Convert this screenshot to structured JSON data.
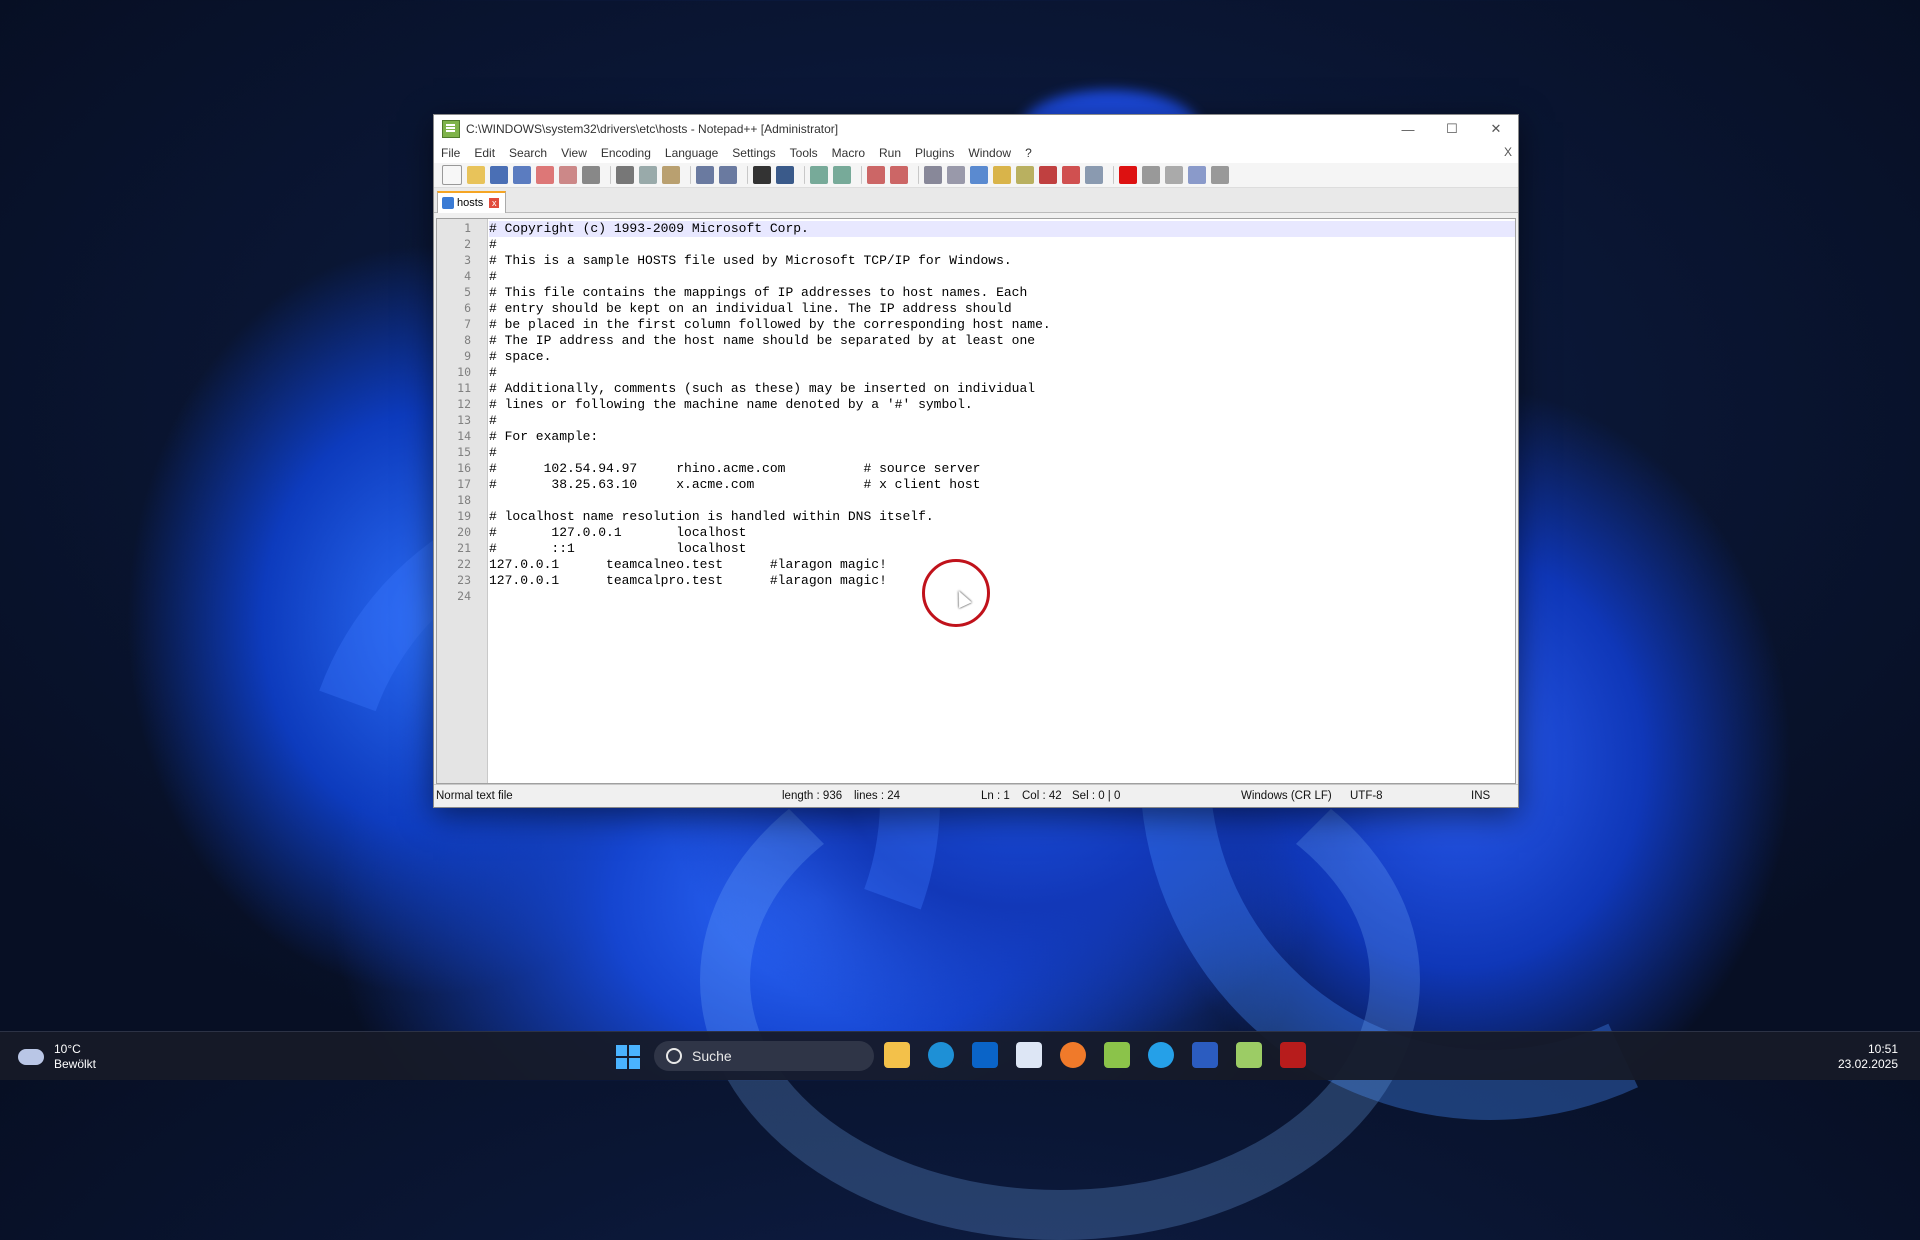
{
  "window": {
    "title": "C:\\WINDOWS\\system32\\drivers\\etc\\hosts - Notepad++ [Administrator]",
    "controls": [
      "—",
      "☐",
      "✕"
    ]
  },
  "menu": {
    "items": [
      "File",
      "Edit",
      "Search",
      "View",
      "Encoding",
      "Language",
      "Settings",
      "Tools",
      "Macro",
      "Run",
      "Plugins",
      "Window",
      "?"
    ],
    "close_label": "X"
  },
  "tab": {
    "label": "hosts"
  },
  "editor": {
    "lines": [
      "# Copyright (c) 1993-2009 Microsoft Corp.",
      "#",
      "# This is a sample HOSTS file used by Microsoft TCP/IP for Windows.",
      "#",
      "# This file contains the mappings of IP addresses to host names. Each",
      "# entry should be kept on an individual line. The IP address should",
      "# be placed in the first column followed by the corresponding host name.",
      "# The IP address and the host name should be separated by at least one",
      "# space.",
      "#",
      "# Additionally, comments (such as these) may be inserted on individual",
      "# lines or following the machine name denoted by a '#' symbol.",
      "#",
      "# For example:",
      "#",
      "#      102.54.94.97     rhino.acme.com          # source server",
      "#       38.25.63.10     x.acme.com              # x client host",
      "",
      "# localhost name resolution is handled within DNS itself.",
      "#\t127.0.0.1       localhost",
      "#\t::1             localhost",
      "127.0.0.1      teamcalneo.test      #laragon magic!",
      "127.0.0.1      teamcalpro.test      #laragon magic!",
      ""
    ],
    "line_numbers": [
      "1",
      "2",
      "3",
      "4",
      "5",
      "6",
      "7",
      "8",
      "9",
      "10",
      "11",
      "12",
      "13",
      "14",
      "15",
      "16",
      "17",
      "18",
      "19",
      "20",
      "21",
      "22",
      "23",
      "24"
    ]
  },
  "status": {
    "file_type": "Normal text file",
    "length": "length : 936",
    "lines": "lines : 24",
    "ln": "Ln : 1",
    "col": "Col : 42",
    "sel": "Sel : 0 | 0",
    "eol": "Windows (CR LF)",
    "encoding": "UTF-8",
    "mode": "INS"
  },
  "taskbar": {
    "weather_temp": "10°C",
    "weather_desc": "Bewölkt",
    "search_label": "Suche",
    "time": "10:51",
    "date": "23.02.2025"
  },
  "colors": {
    "accent": "#f5a524",
    "click_ring": "#c0121b"
  }
}
